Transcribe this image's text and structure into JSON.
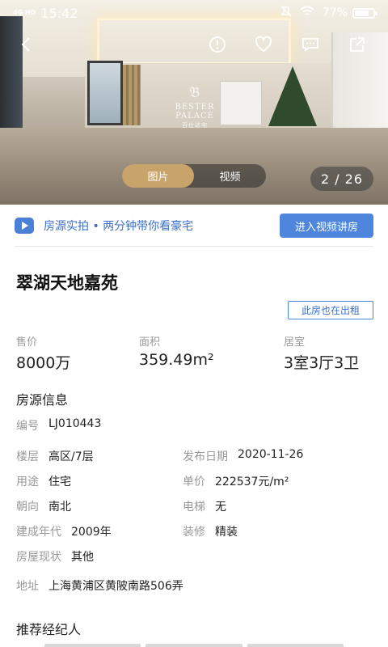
{
  "status_bar": {
    "network": "4G HD",
    "time": "15:42",
    "battery": "77%",
    "battery_level": 0.77,
    "icons": [
      "mute-icon",
      "wifi-icon"
    ]
  },
  "photo_watermark": {
    "line1": "BESTER PALACE",
    "line2": "百仕达宅"
  },
  "top_actions": [
    "back-icon",
    "report-icon",
    "favorite-icon",
    "message-icon",
    "share-icon"
  ],
  "media_toggle": {
    "tabs": [
      {
        "label": "图片",
        "active": true
      },
      {
        "label": "视频",
        "active": false
      }
    ]
  },
  "photo_counter": "2 / 26",
  "video_promo": {
    "text": "房源实拍 • 两分钟带你看豪宅",
    "button": "进入视频讲房"
  },
  "listing": {
    "title": "翠湖天地嘉苑",
    "rent_tag": "此房也在出租",
    "stats": [
      {
        "label": "售价",
        "value": "8000万"
      },
      {
        "label": "面积",
        "value": "359.49m²"
      },
      {
        "label": "居室",
        "value": "3室3厅3卫"
      }
    ]
  },
  "info": {
    "section_title": "房源信息",
    "code": {
      "label": "编号",
      "value": "LJ010443"
    },
    "floor": {
      "label": "楼层",
      "value": "高区/7层"
    },
    "publish_date": {
      "label": "发布日期",
      "value": "2020-11-26"
    },
    "usage": {
      "label": "用途",
      "value": "住宅"
    },
    "unit_price": {
      "label": "单价",
      "value": "222537元/m²"
    },
    "orientation": {
      "label": "朝向",
      "value": "南北"
    },
    "elevator": {
      "label": "电梯",
      "value": "无"
    },
    "build_year": {
      "label": "建成年代",
      "value": "2009年"
    },
    "decoration": {
      "label": "装修",
      "value": "精装"
    },
    "status": {
      "label": "房屋现状",
      "value": "其他"
    },
    "address": {
      "label": "地址",
      "value": "上海黄浦区黄陂南路506弄"
    }
  },
  "agents": {
    "section_title": "推荐经纪人"
  },
  "colors": {
    "accent_blue": "#4e86dd",
    "gold_tab": "#c9a46a"
  }
}
